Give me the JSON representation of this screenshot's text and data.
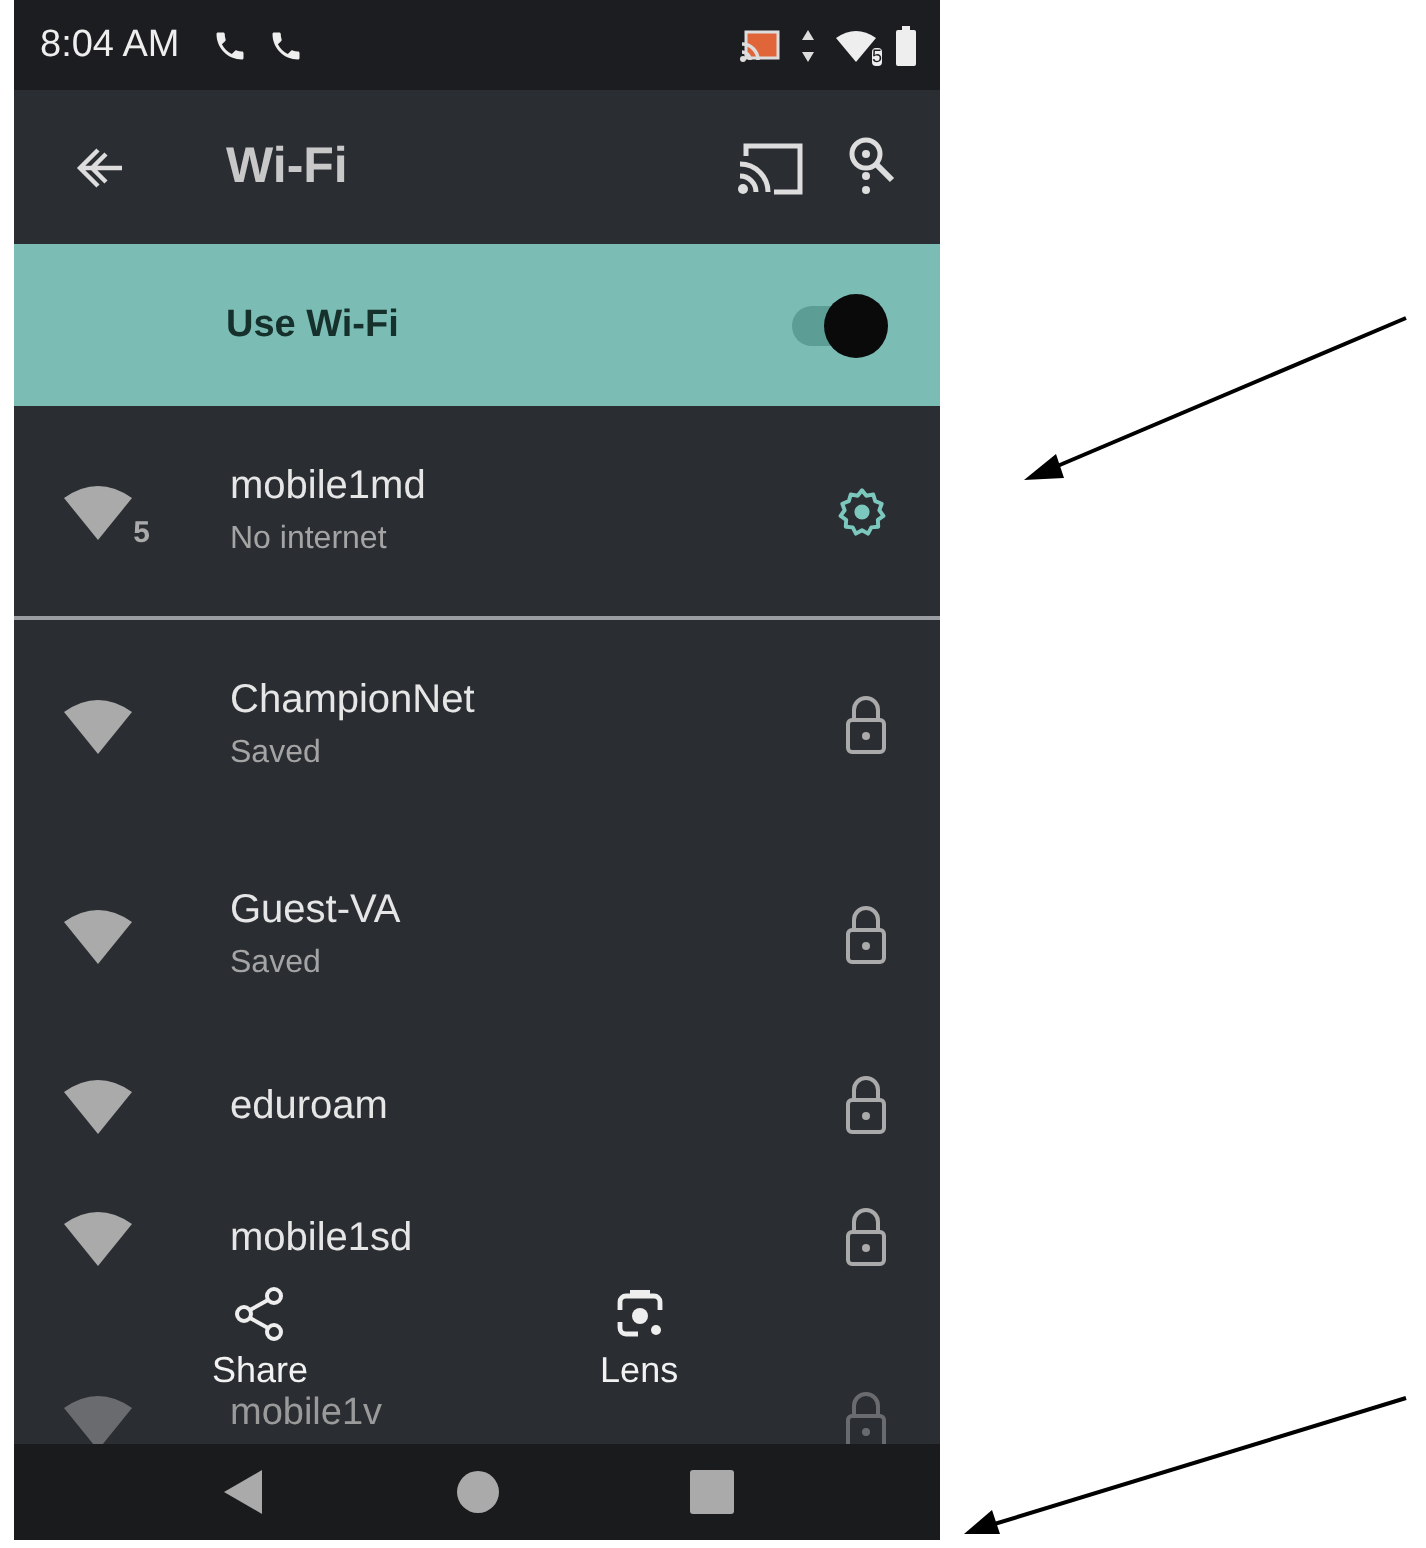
{
  "status_bar": {
    "time": "8:04 AM",
    "wifi_badge": "5"
  },
  "app_bar": {
    "title": "Wi-Fi"
  },
  "wifi_toggle": {
    "label": "Use Wi-Fi",
    "on": true
  },
  "networks": [
    {
      "name": "mobile1md",
      "subtitle": "No internet",
      "kind": "connected",
      "badge": "5"
    },
    {
      "name": "ChampionNet",
      "subtitle": "Saved",
      "kind": "locked"
    },
    {
      "name": "Guest-VA",
      "subtitle": "Saved",
      "kind": "locked"
    },
    {
      "name": "eduroam",
      "kind": "locked"
    },
    {
      "name": "mobile1sd",
      "kind": "locked"
    },
    {
      "name": "mobile1v",
      "kind": "locked"
    }
  ],
  "overlay_actions": [
    {
      "label": "Share",
      "kind": "share"
    },
    {
      "label": "Lens",
      "kind": "lens"
    }
  ]
}
